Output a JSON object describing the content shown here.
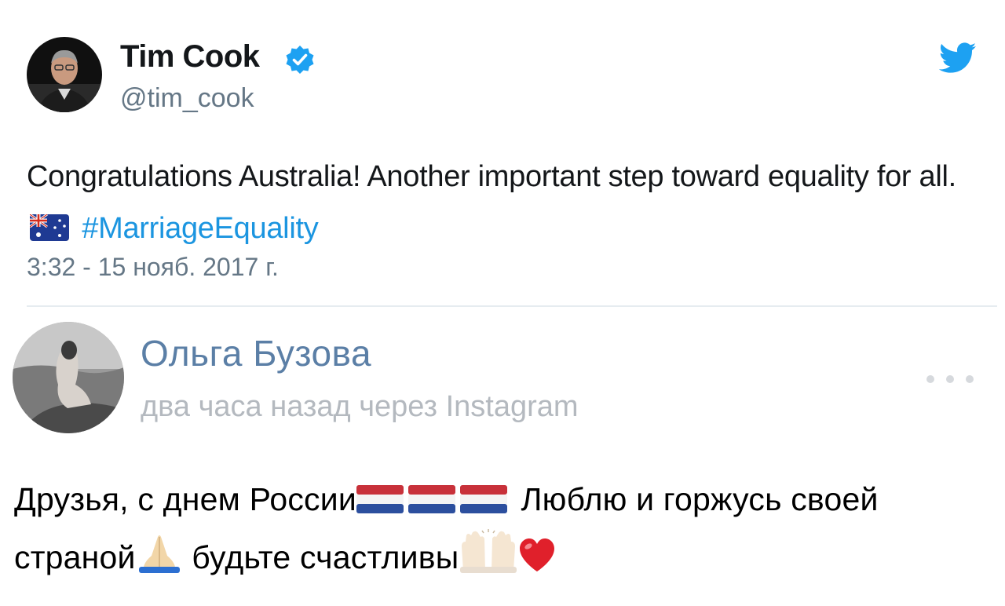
{
  "tweet": {
    "author_name": "Tim Cook",
    "handle": "@tim_cook",
    "text_before": "Congratulations Australia! Another important step toward equality for all.",
    "hashtag": "#MarriageEquality",
    "timestamp": "3:32 - 15 нояб. 2017 г.",
    "icons": [
      "verified-badge-icon",
      "twitter-bird-icon",
      "australia-flag-emoji"
    ],
    "colors": {
      "hashtag": "#1b95e0",
      "verified": "#1da1f2",
      "secondary": "#657786"
    }
  },
  "vk_post": {
    "author_name": "Ольга Бузова",
    "meta": "два часа назад через Instagram",
    "text_part1": "Друзья, с днем России",
    "text_part2": " Люблю и горжусь своей страной",
    "text_part3": " будьте счастливы",
    "icons": [
      "more-options-icon",
      "netherlands-flag-emoji",
      "folded-hands-emoji",
      "raised-hands-emoji",
      "red-heart-emoji"
    ],
    "colors": {
      "name": "#5b7fa6",
      "meta": "#b4b9bf"
    }
  }
}
